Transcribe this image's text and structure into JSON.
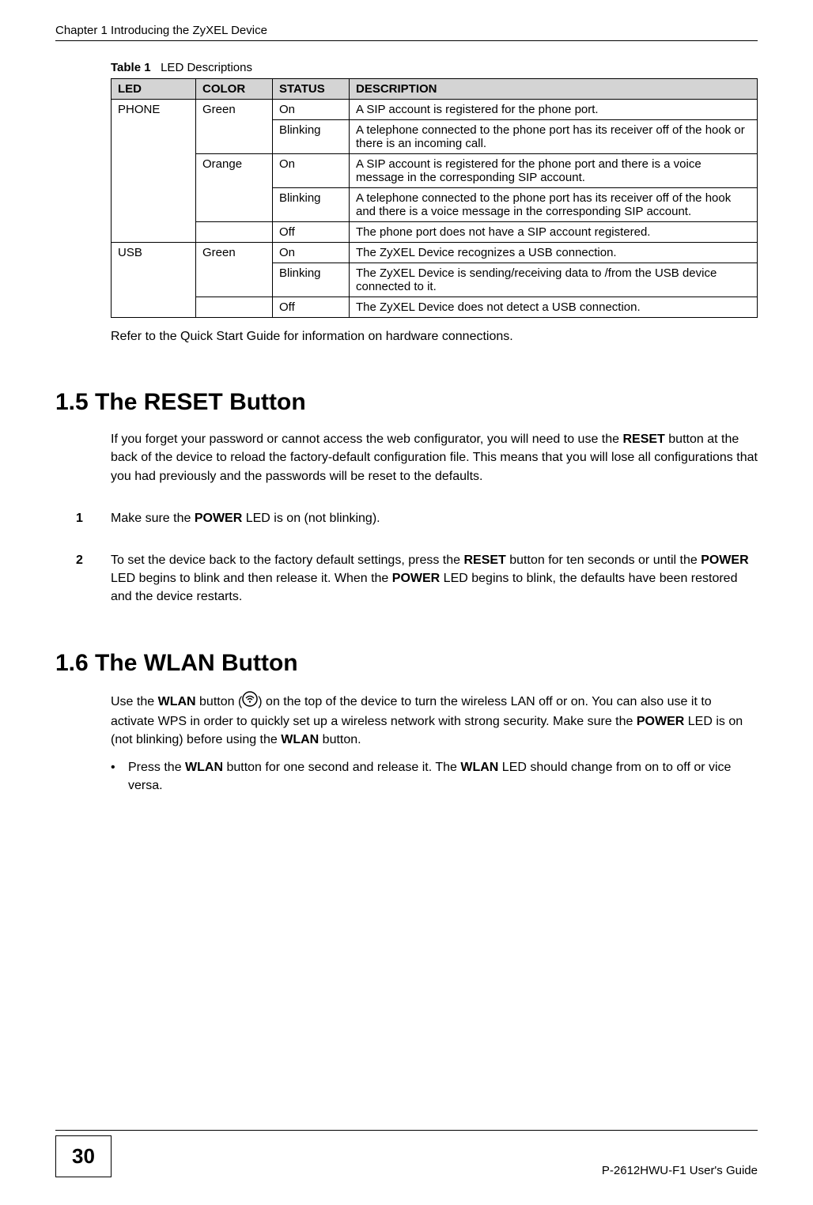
{
  "header": {
    "chapter_title": "Chapter 1 Introducing the ZyXEL Device"
  },
  "table": {
    "caption_label": "Table 1",
    "caption_text": "LED Descriptions",
    "headers": {
      "led": "LED",
      "color": "COLOR",
      "status": "STATUS",
      "description": "DESCRIPTION"
    },
    "rows": {
      "phone": {
        "led": "PHONE",
        "green": "Green",
        "green_on_status": "On",
        "green_on_desc": "A SIP account is registered for the phone port.",
        "green_blink_status": "Blinking",
        "green_blink_desc": "A telephone connected to the phone port has its receiver off of the hook or there is an incoming call.",
        "orange": "Orange",
        "orange_on_status": "On",
        "orange_on_desc": "A SIP account is registered for the phone port and there is a voice message in the corresponding SIP account.",
        "orange_blink_status": "Blinking",
        "orange_blink_desc": "A telephone connected to the phone port has its receiver off of the hook and there is a voice message in the corresponding SIP account.",
        "off_status": "Off",
        "off_desc": "The phone port does not have a SIP account registered."
      },
      "usb": {
        "led": "USB",
        "green": "Green",
        "green_on_status": "On",
        "green_on_desc": "The ZyXEL Device recognizes a USB connection.",
        "green_blink_status": "Blinking",
        "green_blink_desc": "The ZyXEL Device is sending/receiving data to /from the USB device connected to it.",
        "off_status": "Off",
        "off_desc": "The ZyXEL Device does not detect a USB connection."
      }
    }
  },
  "refer_text": "Refer to the Quick Start Guide for information on hardware connections.",
  "section_1_5": {
    "title": "1.5  The RESET Button",
    "intro_a": "If you forget your password or cannot access the web configurator, you will need to use the ",
    "intro_b_bold": "RESET",
    "intro_c": " button at the back of the device to reload the factory-default configuration file. This means that you will lose all configurations that you had previously and the passwords will be reset to the defaults.",
    "step1_num": "1",
    "step1_a": "Make sure the ",
    "step1_b_bold": "POWER",
    "step1_c": " LED is on (not blinking).",
    "step2_num": "2",
    "step2_a": "To set the device back to the factory default settings, press the ",
    "step2_b_bold": "RESET",
    "step2_c": " button for ten seconds or until the ",
    "step2_d_bold": "POWER",
    "step2_e": " LED begins to blink and then release it. When the ",
    "step2_f_bold": "POWER",
    "step2_g": " LED begins to blink, the defaults have been restored and the device restarts."
  },
  "section_1_6": {
    "title": "1.6  The WLAN Button",
    "intro_a": "Use the ",
    "intro_b_bold": "WLAN",
    "intro_c": " button (",
    "intro_d": ") on the top of the device to turn the wireless LAN off or on. You can also use it to activate WPS in order to quickly set up a wireless network with strong security. Make sure the ",
    "intro_e_bold": "POWER",
    "intro_f": " LED is on (not blinking) before using the ",
    "intro_g_bold": "WLAN",
    "intro_h": " button.",
    "bullet_dot": "•",
    "bullet_a": "Press the ",
    "bullet_b_bold": "WLAN",
    "bullet_c": " button for one second and release it. The ",
    "bullet_d_bold": "WLAN",
    "bullet_e": " LED should change from on to off or vice versa."
  },
  "footer": {
    "page_number": "30",
    "guide": "P-2612HWU-F1 User's Guide"
  }
}
